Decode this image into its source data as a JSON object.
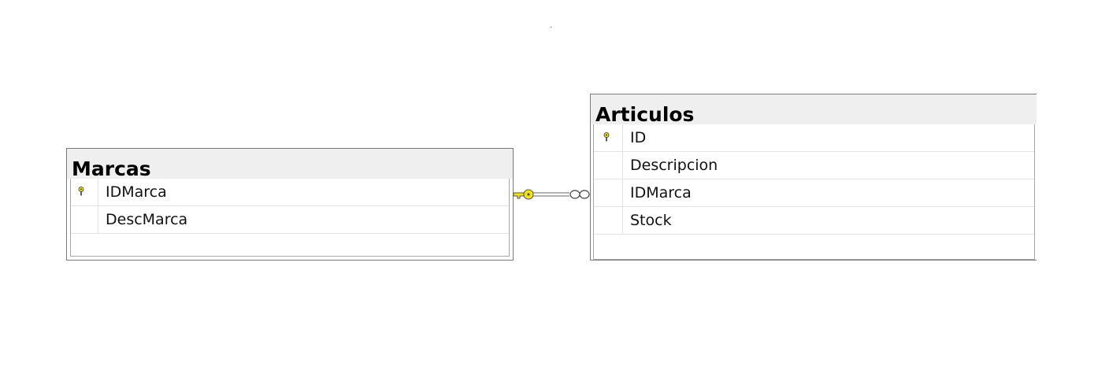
{
  "tables": {
    "marcas": {
      "title": "Marcas",
      "columns": [
        {
          "name": "IDMarca",
          "primary_key": true
        },
        {
          "name": "DescMarca",
          "primary_key": false
        }
      ]
    },
    "articulos": {
      "title": "Articulos",
      "columns": [
        {
          "name": "ID",
          "primary_key": true
        },
        {
          "name": "Descripcion",
          "primary_key": false
        },
        {
          "name": "IDMarca",
          "primary_key": false
        },
        {
          "name": "Stock",
          "primary_key": false
        }
      ]
    }
  },
  "relationship": {
    "from": "Marcas",
    "to": "Articulos",
    "one_side": "key-icon",
    "many_side": "infinity-icon"
  },
  "colors": {
    "key": "#f2e31b",
    "header": "#efefef",
    "border": "#7a7a7a"
  }
}
